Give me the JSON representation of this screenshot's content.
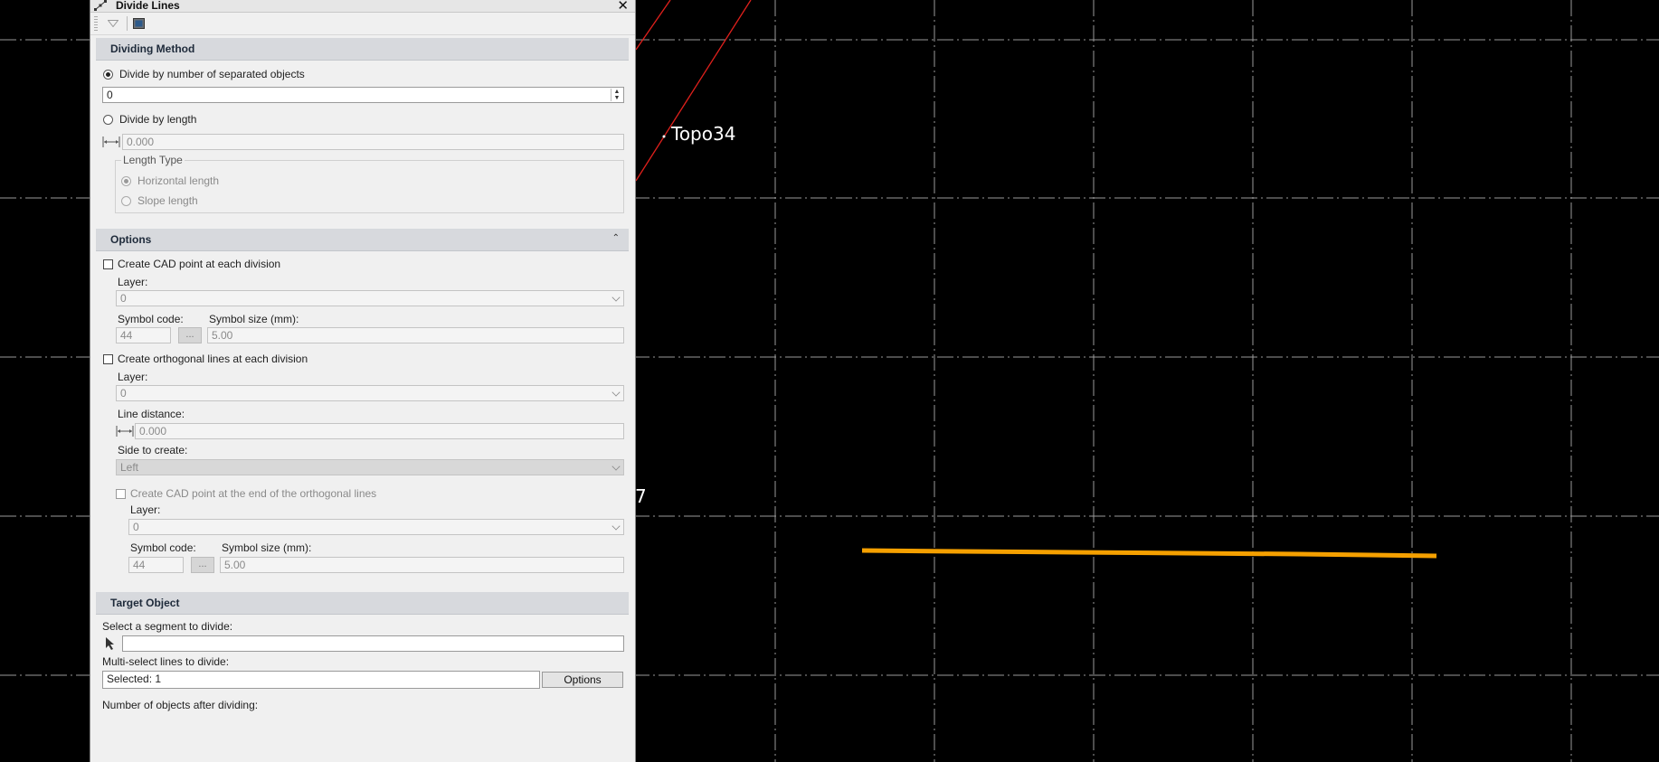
{
  "canvas": {
    "labels": {
      "topo34": "Topo34",
      "partial_label": "7"
    }
  },
  "panel": {
    "title": "Divide Lines",
    "close_glyph": "✕",
    "icons": {
      "title_icon": "divide-lines-icon",
      "toolbar_1": "triangle-down-icon",
      "toolbar_2": "properties-icon"
    }
  },
  "dividing_method": {
    "title": "Dividing Method",
    "by_number": {
      "label": "Divide by number of separated objects",
      "selected": true,
      "value": "0"
    },
    "by_length": {
      "label": "Divide by length",
      "selected": false,
      "value": "0.000"
    },
    "length_type": {
      "title": "Length Type",
      "horizontal": {
        "label": "Horizontal length",
        "selected": true
      },
      "slope": {
        "label": "Slope length",
        "selected": false
      }
    }
  },
  "options": {
    "title": "Options",
    "collapse_glyph": "⌃",
    "cad_point": {
      "label": "Create CAD point at each division",
      "checked": false,
      "layer_label": "Layer:",
      "layer_value": "0",
      "symbol_code_label": "Symbol code:",
      "symbol_code": "44",
      "ellipsis": "...",
      "symbol_size_label": "Symbol size (mm):",
      "symbol_size": "5.00"
    },
    "orthogonal": {
      "label": "Create orthogonal lines at each division",
      "checked": false,
      "layer_label": "Layer:",
      "layer_value": "0",
      "distance_label": "Line distance:",
      "distance_value": "0.000",
      "side_label": "Side to create:",
      "side_value": "Left",
      "end_point": {
        "label": "Create CAD point at the end of the orthogonal lines",
        "checked": false,
        "layer_label": "Layer:",
        "layer_value": "0",
        "symbol_code_label": "Symbol code:",
        "symbol_code": "44",
        "ellipsis": "...",
        "symbol_size_label": "Symbol size (mm):",
        "symbol_size": "5.00"
      }
    }
  },
  "target": {
    "title": "Target Object",
    "select_label": "Select a segment to divide:",
    "select_value": "",
    "multi_label": "Multi-select lines to divide:",
    "multi_value": "Selected: 1",
    "options_button": "Options",
    "count_label": "Number of objects after dividing:"
  },
  "colors": {
    "background": "#000000",
    "grid": "#9a9a9a",
    "red_line": "#e0201c",
    "orange_line": "#f5a000"
  }
}
